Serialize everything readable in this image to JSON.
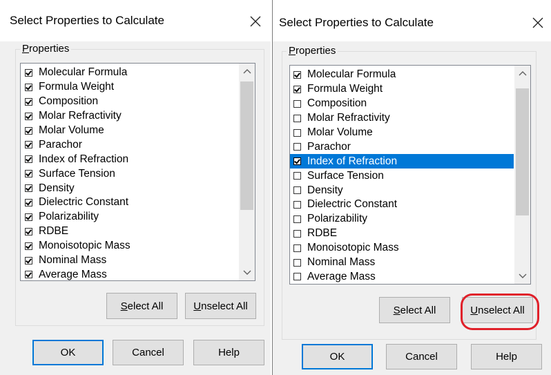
{
  "dialogs": [
    {
      "title": "Select Properties to Calculate",
      "group_label": {
        "accel": "P",
        "rest": "roperties"
      },
      "items": [
        {
          "label": "Molecular Formula",
          "checked": true,
          "selected": false
        },
        {
          "label": "Formula Weight",
          "checked": true,
          "selected": false
        },
        {
          "label": "Composition",
          "checked": true,
          "selected": false
        },
        {
          "label": "Molar Refractivity",
          "checked": true,
          "selected": false
        },
        {
          "label": "Molar Volume",
          "checked": true,
          "selected": false
        },
        {
          "label": "Parachor",
          "checked": true,
          "selected": false
        },
        {
          "label": "Index of Refraction",
          "checked": true,
          "selected": false
        },
        {
          "label": "Surface Tension",
          "checked": true,
          "selected": false
        },
        {
          "label": "Density",
          "checked": true,
          "selected": false
        },
        {
          "label": "Dielectric Constant",
          "checked": true,
          "selected": false
        },
        {
          "label": "Polarizability",
          "checked": true,
          "selected": false
        },
        {
          "label": "RDBE",
          "checked": true,
          "selected": false
        },
        {
          "label": "Monoisotopic Mass",
          "checked": true,
          "selected": false
        },
        {
          "label": "Nominal Mass",
          "checked": true,
          "selected": false
        },
        {
          "label": "Average Mass",
          "checked": true,
          "selected": false
        }
      ],
      "select_all": {
        "accel": "S",
        "rest": "elect All"
      },
      "unselect_all": {
        "accel": "U",
        "rest": "nselect All"
      },
      "ok_label": "OK",
      "cancel_label": "Cancel",
      "help_label": "Help"
    },
    {
      "title": "Select Properties to Calculate",
      "group_label": {
        "accel": "P",
        "rest": "roperties"
      },
      "items": [
        {
          "label": "Molecular Formula",
          "checked": true,
          "selected": false
        },
        {
          "label": "Formula Weight",
          "checked": true,
          "selected": false
        },
        {
          "label": "Composition",
          "checked": false,
          "selected": false
        },
        {
          "label": "Molar Refractivity",
          "checked": false,
          "selected": false
        },
        {
          "label": "Molar Volume",
          "checked": false,
          "selected": false
        },
        {
          "label": "Parachor",
          "checked": false,
          "selected": false
        },
        {
          "label": "Index of Refraction",
          "checked": true,
          "selected": true
        },
        {
          "label": "Surface Tension",
          "checked": false,
          "selected": false
        },
        {
          "label": "Density",
          "checked": false,
          "selected": false
        },
        {
          "label": "Dielectric Constant",
          "checked": false,
          "selected": false
        },
        {
          "label": "Polarizability",
          "checked": false,
          "selected": false
        },
        {
          "label": "RDBE",
          "checked": false,
          "selected": false
        },
        {
          "label": "Monoisotopic Mass",
          "checked": false,
          "selected": false
        },
        {
          "label": "Nominal Mass",
          "checked": false,
          "selected": false
        },
        {
          "label": "Average Mass",
          "checked": false,
          "selected": false
        }
      ],
      "select_all": {
        "accel": "S",
        "rest": "elect All"
      },
      "unselect_all": {
        "accel": "U",
        "rest": "nselect All"
      },
      "ok_label": "OK",
      "cancel_label": "Cancel",
      "help_label": "Help"
    }
  ],
  "colors": {
    "selection": "#0078d7",
    "highlight_ring": "#e0202a",
    "default_button_border": "#0078d7"
  },
  "icons": {
    "close": "close-icon",
    "scroll_up": "chevron-up-icon",
    "scroll_down": "chevron-down-icon",
    "checkbox": "checkbox-icon"
  }
}
